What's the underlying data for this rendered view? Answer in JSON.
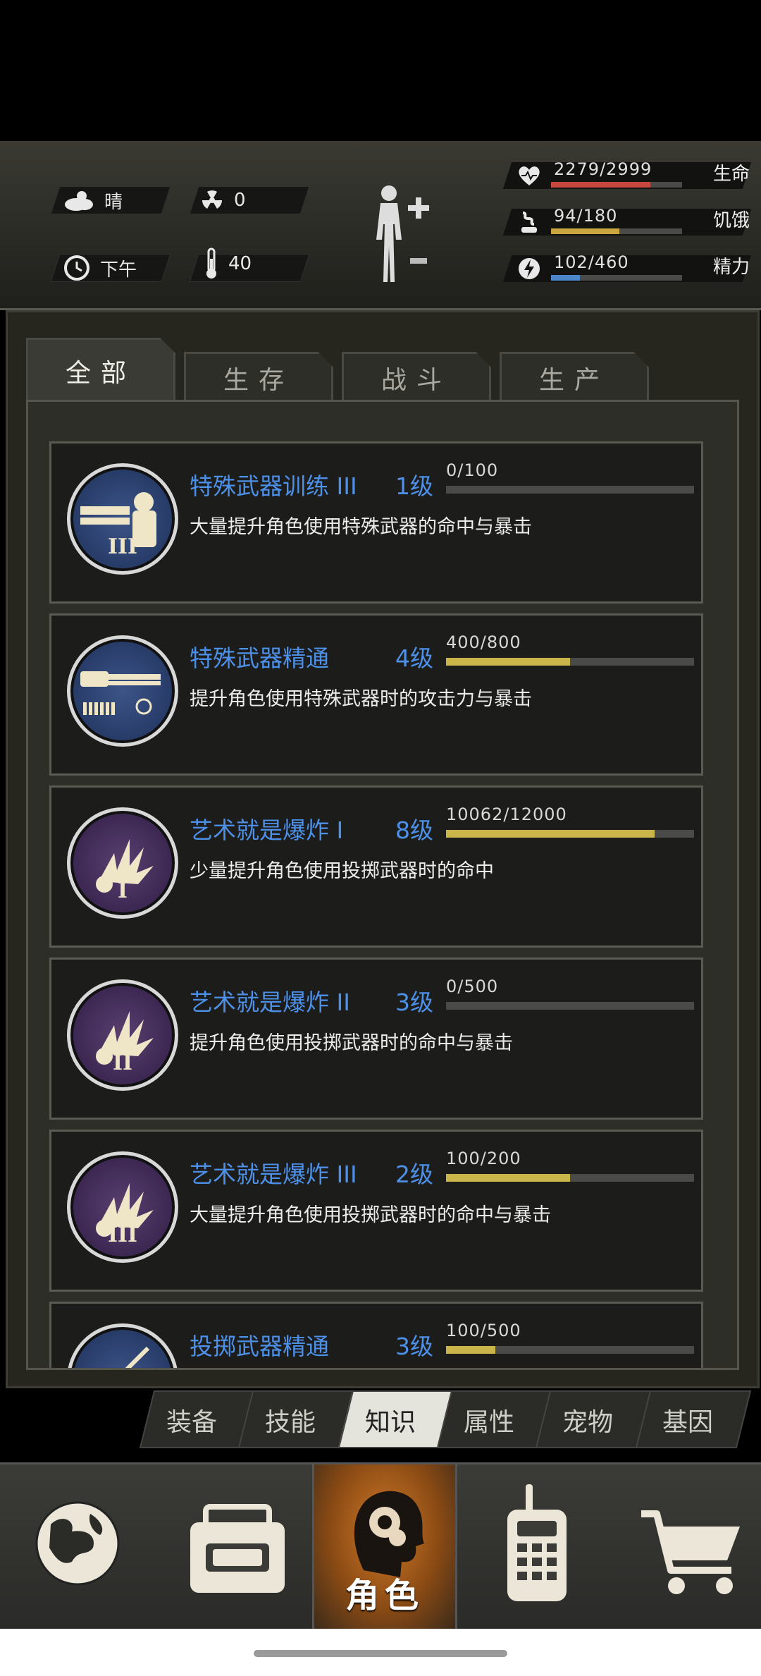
{
  "status": {
    "weather": {
      "icon": "cloud-sun-icon",
      "label": "晴"
    },
    "radiation": {
      "icon": "radiation-icon",
      "value": "0"
    },
    "time": {
      "icon": "clock-icon",
      "label": "下午"
    },
    "temperature": {
      "icon": "thermometer-icon",
      "value": "40"
    },
    "body_icon": "body-figure-icon",
    "stats": [
      {
        "name": "health",
        "icon": "heart-icon",
        "text": "2279/2999",
        "label": "生命",
        "fraction": 0.76,
        "color": "#c8473f"
      },
      {
        "name": "hunger",
        "icon": "hunger-icon",
        "text": "94/180",
        "label": "饥饿",
        "fraction": 0.52,
        "color": "#c9a640"
      },
      {
        "name": "energy",
        "icon": "energy-icon",
        "text": "102/460",
        "label": "精力",
        "fraction": 0.22,
        "color": "#4a86c8"
      }
    ]
  },
  "tabs": [
    {
      "label": "全部",
      "active": true
    },
    {
      "label": "生存",
      "active": false
    },
    {
      "label": "战斗",
      "active": false
    },
    {
      "label": "生产",
      "active": false
    }
  ],
  "skills": [
    {
      "title": "特殊武器训练 III",
      "level": "1级",
      "progress": "0/100",
      "fraction": 0.0,
      "desc": "大量提升角色使用特殊武器的命中与暴击",
      "icon": "minigun-soldier-icon",
      "roman": "III",
      "theme": "blue"
    },
    {
      "title": "特殊武器精通",
      "level": "4级",
      "progress": "400/800",
      "fraction": 0.5,
      "desc": "提升角色使用特殊武器时的攻击力与暴击",
      "icon": "minigun-ammo-icon",
      "roman": "",
      "theme": "blue"
    },
    {
      "title": "艺术就是爆炸 I",
      "level": "8级",
      "progress": "10062/12000",
      "fraction": 0.84,
      "desc": "少量提升角色使用投掷武器时的命中",
      "icon": "explosion-icon",
      "roman": "I",
      "theme": "purple"
    },
    {
      "title": "艺术就是爆炸 II",
      "level": "3级",
      "progress": "0/500",
      "fraction": 0.0,
      "desc": "提升角色使用投掷武器时的命中与暴击",
      "icon": "explosion-icon",
      "roman": "II",
      "theme": "purple"
    },
    {
      "title": "艺术就是爆炸 III",
      "level": "2级",
      "progress": "100/200",
      "fraction": 0.5,
      "desc": "大量提升角色使用投掷武器时的命中与暴击",
      "icon": "explosion-icon",
      "roman": "III",
      "theme": "purple"
    },
    {
      "title": "投掷武器精通",
      "level": "3级",
      "progress": "100/500",
      "fraction": 0.2,
      "desc": "",
      "icon": "throwing-weapon-icon",
      "roman": "",
      "theme": "blue"
    }
  ],
  "subtabs": [
    {
      "label": "装备",
      "active": false
    },
    {
      "label": "技能",
      "active": false
    },
    {
      "label": "知识",
      "active": true
    },
    {
      "label": "属性",
      "active": false
    },
    {
      "label": "宠物",
      "active": false
    },
    {
      "label": "基因",
      "active": false
    }
  ],
  "bottom_nav": [
    {
      "name": "map",
      "icon": "globe-icon",
      "label": ""
    },
    {
      "name": "inventory",
      "icon": "backpack-icon",
      "label": ""
    },
    {
      "name": "character",
      "icon": "head-gear-icon",
      "label": "角色",
      "active": true
    },
    {
      "name": "radio",
      "icon": "walkie-talkie-icon",
      "label": ""
    },
    {
      "name": "shop",
      "icon": "shopping-cart-icon",
      "label": ""
    }
  ]
}
